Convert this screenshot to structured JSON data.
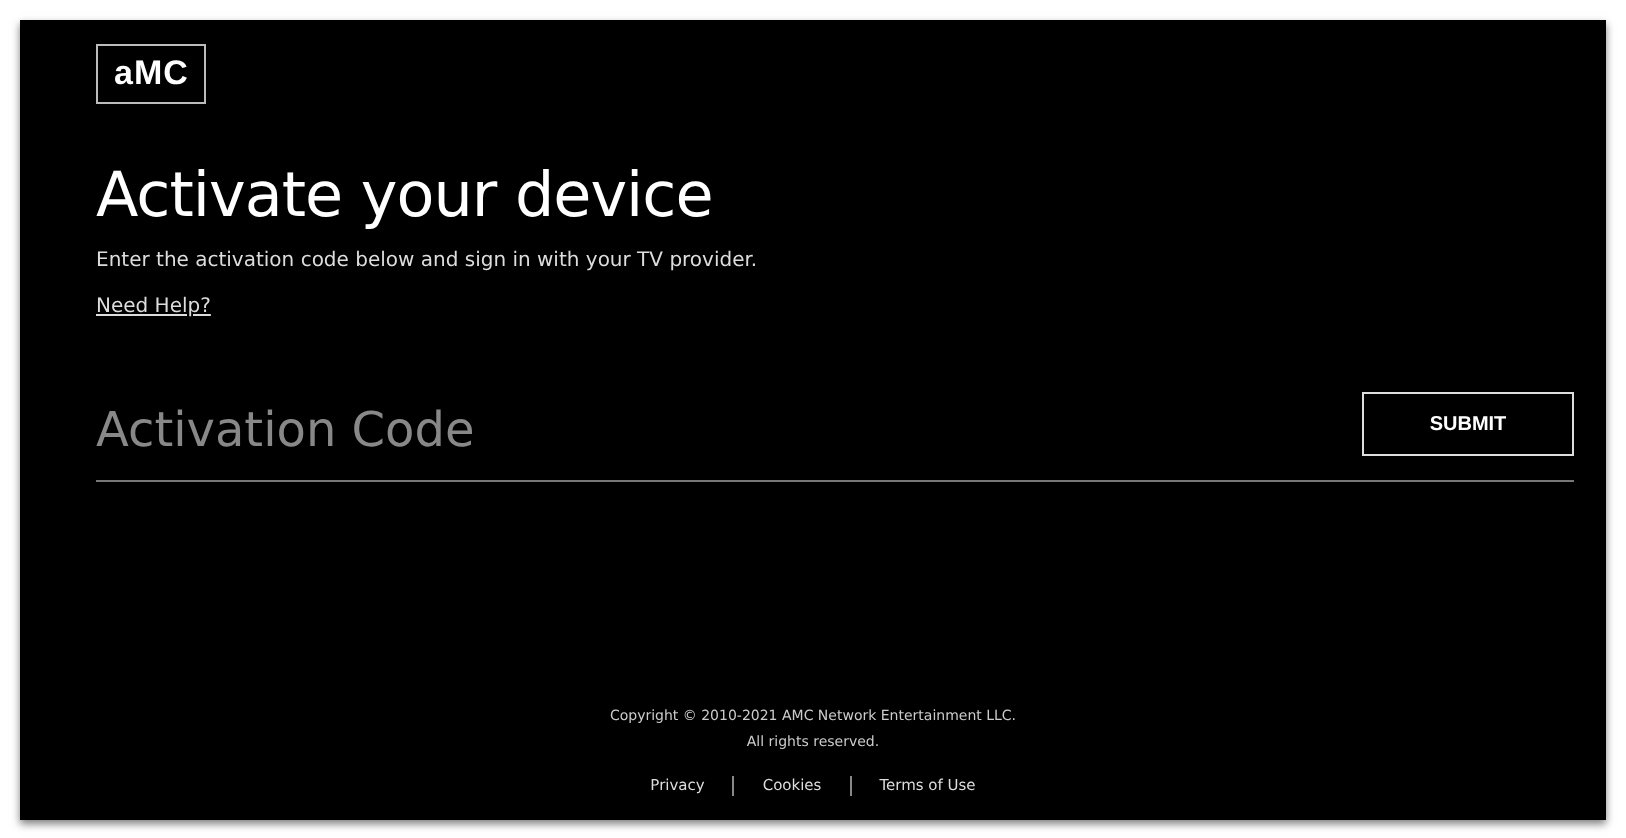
{
  "logo": {
    "text": "aMC"
  },
  "heading": "Activate your device",
  "instructions": "Enter the activation code below and sign in with your TV provider.",
  "help_link": "Need Help?",
  "activation_field": {
    "placeholder": "Activation Code"
  },
  "submit_button": "SUBMIT",
  "footer": {
    "copyright": "Copyright © 2010-2021 AMC Network Entertainment LLC.",
    "rights": "All rights reserved.",
    "links": [
      "Privacy",
      "Cookies",
      "Terms of Use"
    ]
  }
}
